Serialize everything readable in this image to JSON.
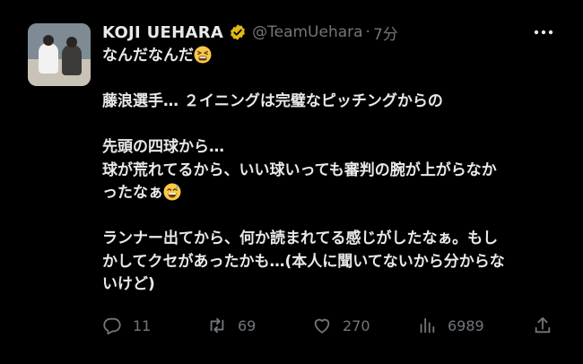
{
  "author": {
    "name": "KOJI UEHARA",
    "handle": "@TeamUehara",
    "time": "7分"
  },
  "tweet": {
    "lines": [
      "なんだなんだ",
      "藤浪選手… ２イニングは完璧なピッチングからの",
      "先頭の四球から…",
      "球が荒れてるから、いい球いっても審判の腕が上がらなか",
      "ったなぁ",
      "ランナー出てから、何か読まれてる感じがしたなぁ。もし",
      "かしてクセがあったかも…(本人に聞いてないから分からな",
      "いけど)"
    ]
  },
  "stats": {
    "replies": "11",
    "retweets": "69",
    "likes": "270",
    "views": "6989"
  },
  "icons": {
    "verified": "verified-badge-icon",
    "more": "more-dots-icon",
    "reply": "reply-icon",
    "retweet": "retweet-icon",
    "like": "heart-icon",
    "views": "views-chart-icon",
    "share": "share-icon"
  },
  "colors": {
    "background": "#000000",
    "text": "#e7e9ea",
    "muted": "#71767b",
    "verified_gold": "#e2b719"
  }
}
